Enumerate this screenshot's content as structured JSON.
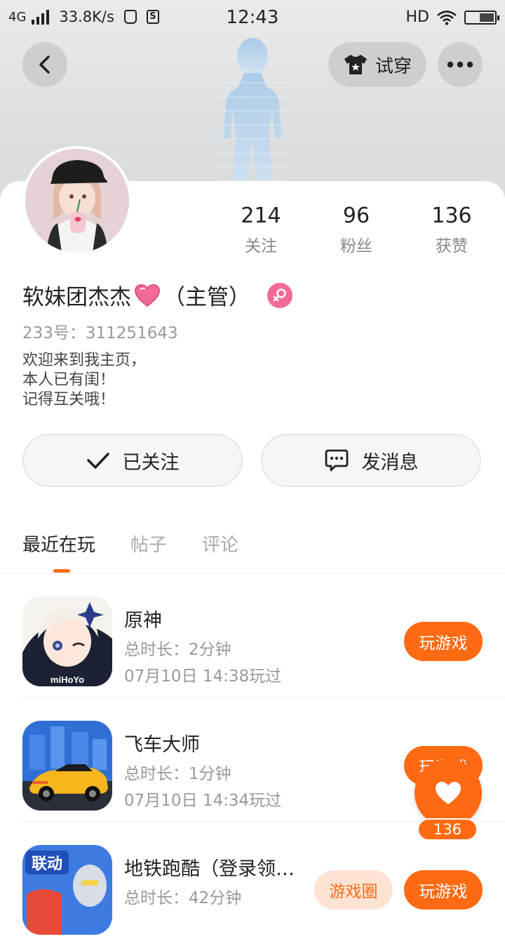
{
  "status_bar": {
    "network": "4G",
    "speed": "33.8K/s",
    "time": "12:43",
    "hd": "HD"
  },
  "header": {
    "try_on_label": "试穿"
  },
  "profile": {
    "stats": [
      {
        "value": "214",
        "label": "关注"
      },
      {
        "value": "96",
        "label": "粉丝"
      },
      {
        "value": "136",
        "label": "获赞"
      }
    ],
    "name": "软妹团杰杰",
    "name_suffix": "（主管）",
    "uid": "233号：311251643",
    "bio": "欢迎来到我主页，\n本人已有闺！\n记得互关哦！",
    "follow_label": "已关注",
    "message_label": "发消息"
  },
  "tabs": [
    {
      "label": "最近在玩",
      "active": true
    },
    {
      "label": "帖子",
      "active": false
    },
    {
      "label": "评论",
      "active": false
    }
  ],
  "games": [
    {
      "title": "原神",
      "duration": "总时长：2分钟",
      "last_played": "07月10日 14:38玩过",
      "play_label": "玩游戏",
      "icon": "genshin-icon"
    },
    {
      "title": "飞车大师",
      "duration": "总时长：1分钟",
      "last_played": "07月10日 14:34玩过",
      "play_label": "玩游戏",
      "icon": "racing-icon"
    },
    {
      "title": "地铁跑酷（登录领…",
      "duration": "总时长：42分钟",
      "circle_label": "游戏圈",
      "play_label": "玩游戏",
      "icon": "subway-icon"
    }
  ],
  "like_fab": {
    "count": "136"
  },
  "colors": {
    "accent": "#ff6a13",
    "gender": "#f06b95"
  }
}
